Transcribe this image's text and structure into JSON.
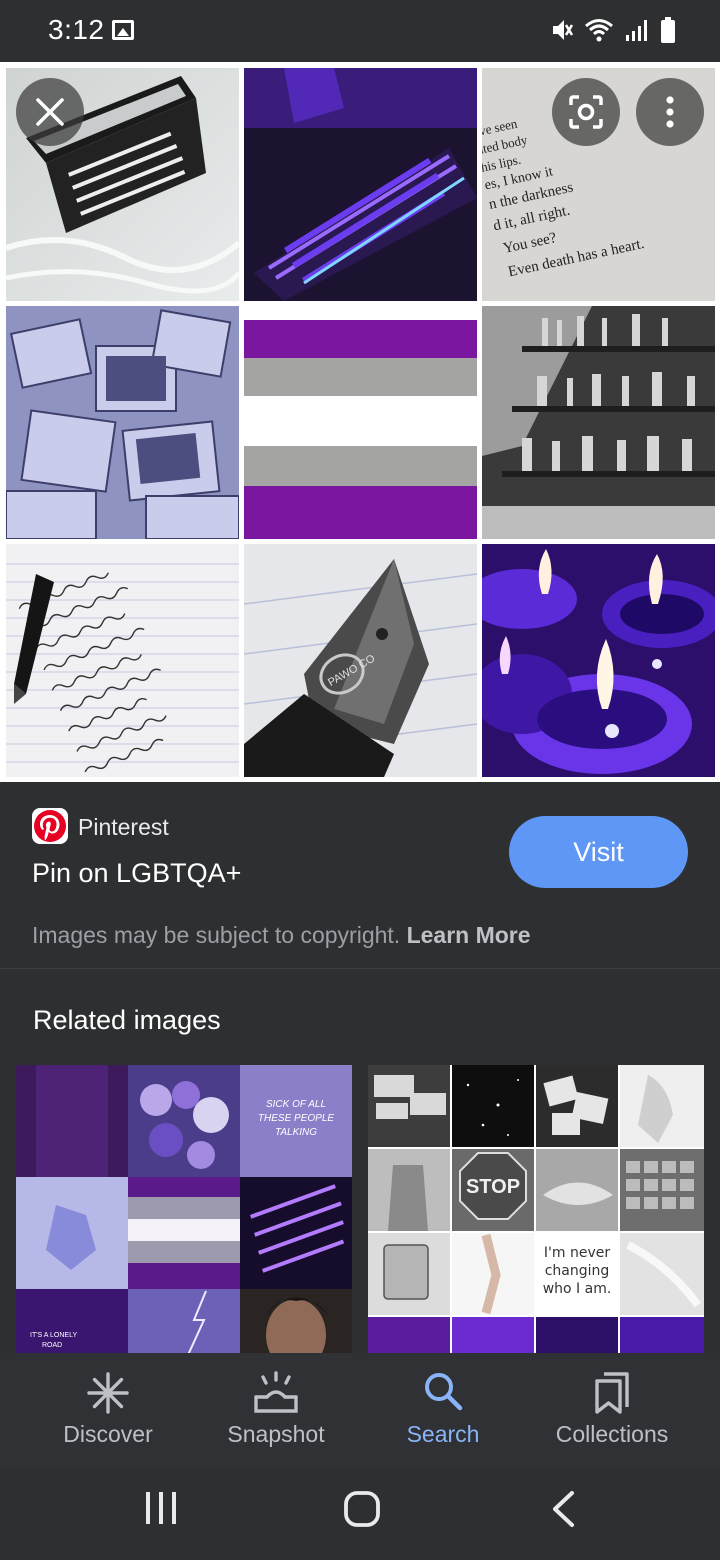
{
  "status_bar": {
    "time": "3:12",
    "icons": [
      "gallery-icon",
      "mute-icon",
      "wifi-icon",
      "signal-icon",
      "battery-icon"
    ]
  },
  "image_grid": {
    "overlay_icons": [
      "close-icon",
      "lens-icon",
      "more-vert-icon"
    ],
    "tile_text": {
      "book_lines": [
        "ave seen",
        "ated body",
        "his lips.",
        "es, I know it",
        "n the darkness",
        "d it, all right.",
        "You see?",
        "Even death has a heart."
      ],
      "pen_logo": "PAWO CO"
    }
  },
  "result": {
    "source_name": "Pinterest",
    "title": "Pin on LGBTQA+",
    "visit_label": "Visit",
    "copyright_text": "Images may be subject to copyright.",
    "learn_more_label": "Learn More"
  },
  "related": {
    "heading": "Related images",
    "image1_text": [
      "SICK OF ALL",
      "THESE PEOPLE",
      "TALKING",
      "IT'S A LONELY",
      "ROAD"
    ],
    "image2_text": [
      "STOP",
      "I'm never",
      "changing",
      "who I am."
    ]
  },
  "bottom_nav": {
    "items": [
      {
        "label": "Discover",
        "icon": "asterisk-icon"
      },
      {
        "label": "Snapshot",
        "icon": "snapshot-icon"
      },
      {
        "label": "Search",
        "icon": "search-icon"
      },
      {
        "label": "Collections",
        "icon": "collections-icon"
      }
    ],
    "active": "Search"
  },
  "system_nav": [
    "recents-icon",
    "home-icon",
    "back-icon"
  ],
  "colors": {
    "accent": "#8ab4f8",
    "visit_button": "#5e97f6",
    "background": "#2d2f31",
    "purple": "#7b16a0",
    "gray": "#a4a5a3"
  }
}
